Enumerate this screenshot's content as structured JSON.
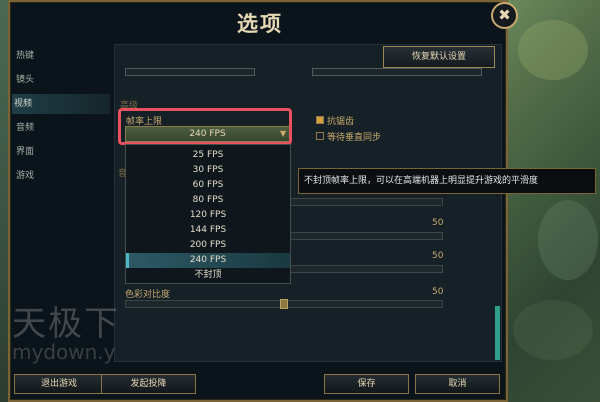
{
  "window": {
    "title": "选项",
    "close_symbol": "✖"
  },
  "sidebar": {
    "items": [
      {
        "label": "热键"
      },
      {
        "label": "镜头"
      },
      {
        "label": "视频",
        "active": true
      },
      {
        "label": "音频"
      },
      {
        "label": "界面"
      },
      {
        "label": "游戏"
      }
    ]
  },
  "header": {
    "restore_defaults_label": "恢复默认设置"
  },
  "graphics": {
    "section_label": "高级",
    "frame_rate_cap_label": "帧率上限",
    "frame_rate_cap_value": "240 FPS",
    "options": [
      "25 FPS",
      "30 FPS",
      "60 FPS",
      "80 FPS",
      "120 FPS",
      "144 FPS",
      "200 FPS",
      "240 FPS",
      "不封顶"
    ],
    "selected_option": "240 FPS",
    "anti_aliasing_label": "抗锯齿",
    "anti_aliasing_checked": true,
    "vsync_label": "等待垂直同步",
    "vsync_checked": false,
    "tooltip": "不封顶帧率上限，可以在高端机器上明显提升游戏的平滑度",
    "partial_label": "音",
    "slider_value_1": "50",
    "slider_value_2": "50",
    "color_contrast_label": "色彩对比度",
    "color_contrast_value": "50",
    "color_contrast_level": 0.5
  },
  "footer": {
    "exit_game_label": "退出游戏",
    "surrender_label": "发起投降",
    "save_label": "保存",
    "cancel_label": "取消"
  },
  "watermark": {
    "text": "天极下",
    "url": "mydown.y"
  },
  "colors": {
    "accent_gold": "#c8aa6e",
    "selection_teal": "#2d5a66",
    "highlight_red": "#e8515e"
  }
}
